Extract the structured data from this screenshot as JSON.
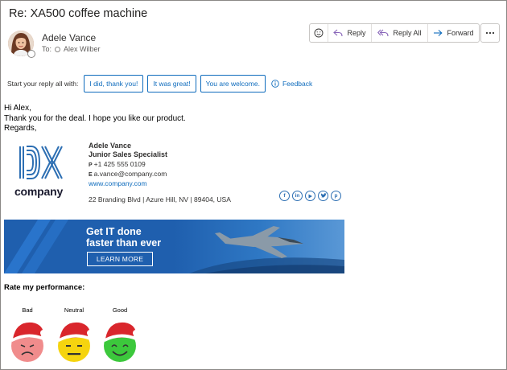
{
  "email": {
    "subject": "Re: XA500 coffee machine",
    "sender_name": "Adele Vance",
    "to_label": "To:",
    "recipient": "Alex Wilber"
  },
  "actions": {
    "reply": "Reply",
    "reply_all": "Reply All",
    "forward": "Forward"
  },
  "quick_replies": {
    "label": "Start your reply all with:",
    "options": [
      "I did, thank you!",
      "It was great!",
      "You are welcome."
    ],
    "feedback": "Feedback"
  },
  "body": {
    "lines": [
      "Hi Alex,",
      "Thank you for the deal. I hope you like our product.",
      "Regards,"
    ]
  },
  "signature": {
    "logo_text": "company",
    "name": "Adele Vance",
    "title": "Junior Sales Specialist",
    "phone_label": "P",
    "phone": "+1 425 555 0109",
    "email_label": "E",
    "email": "a.vance@company.com",
    "website": "www.company.com",
    "address": "22 Branding Blvd | Azure Hill, NV | 89404, USA",
    "socials": [
      "facebook-icon",
      "linkedin-icon",
      "youtube-icon",
      "twitter-icon",
      "pinterest-icon"
    ]
  },
  "banner": {
    "title_line1": "Get IT done",
    "title_line2": "faster than ever",
    "button": "LEARN MORE"
  },
  "rating": {
    "title": "Rate my performance:",
    "options": [
      "Bad",
      "Neutral",
      "Good"
    ]
  },
  "colors": {
    "accent": "#0f6cbd",
    "banner": "#1f5fae",
    "bad": "#f08c8c",
    "neutral": "#f5d40f",
    "good": "#3cc83c",
    "santa_hat": "#d9262c"
  }
}
